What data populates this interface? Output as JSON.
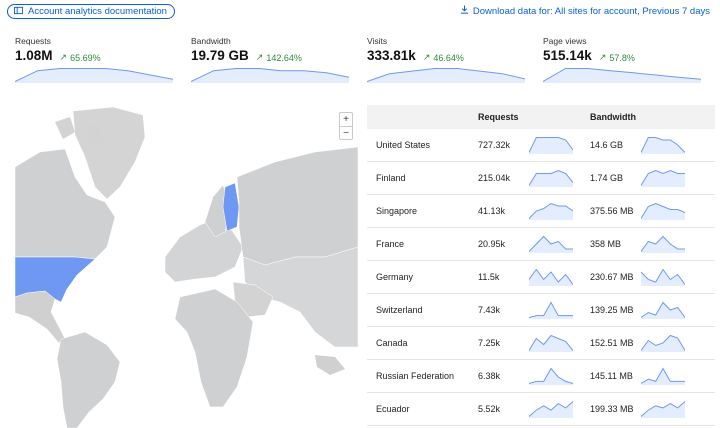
{
  "toolbar": {
    "docs_label": "Account analytics documentation",
    "download_label": "Download data for: All sites for account, Previous 7 days"
  },
  "metrics": [
    {
      "label": "Requests",
      "value": "1.08M",
      "delta": "65.69%",
      "series": [
        1,
        6,
        7,
        7,
        7,
        6,
        4,
        2
      ]
    },
    {
      "label": "Bandwidth",
      "value": "19.79 GB",
      "delta": "142.64%",
      "series": [
        1,
        6,
        7,
        7,
        6,
        6,
        5,
        3
      ]
    },
    {
      "label": "Visits",
      "value": "333.81k",
      "delta": "46.64%",
      "series": [
        1,
        4,
        5,
        6,
        6,
        5,
        4,
        2
      ]
    },
    {
      "label": "Page views",
      "value": "515.14k",
      "delta": "57.8%",
      "series": [
        1,
        7,
        7,
        6,
        5,
        4,
        3,
        2
      ]
    }
  ],
  "map": {
    "zoom_in": "+",
    "zoom_out": "−",
    "highlight_color": "#6f98f2"
  },
  "table": {
    "headers": {
      "country": "",
      "requests": "Requests",
      "bandwidth": "Bandwidth"
    },
    "rows": [
      {
        "country": "United States",
        "requests": "727.32k",
        "bandwidth": "14.6 GB",
        "req_series": [
          2,
          8,
          8,
          8,
          8,
          7,
          3
        ],
        "bw_series": [
          2,
          8,
          8,
          7,
          7,
          5,
          2
        ]
      },
      {
        "country": "Finland",
        "requests": "215.04k",
        "bandwidth": "1.74 GB",
        "req_series": [
          2,
          6,
          6,
          6,
          7,
          6,
          3
        ],
        "bw_series": [
          2,
          6,
          7,
          6,
          7,
          6,
          6
        ]
      },
      {
        "country": "Singapore",
        "requests": "41.13k",
        "bandwidth": "375.56 MB",
        "req_series": [
          2,
          5,
          6,
          8,
          7,
          7,
          5
        ],
        "bw_series": [
          3,
          7,
          8,
          7,
          6,
          6,
          5
        ]
      },
      {
        "country": "France",
        "requests": "20.95k",
        "bandwidth": "358 MB",
        "req_series": [
          2,
          5,
          8,
          5,
          6,
          3,
          3
        ],
        "bw_series": [
          2,
          6,
          5,
          8,
          5,
          3,
          3
        ]
      },
      {
        "country": "Germany",
        "requests": "11.5k",
        "bandwidth": "230.67 MB",
        "req_series": [
          4,
          8,
          4,
          7,
          3,
          6,
          2
        ],
        "bw_series": [
          7,
          4,
          3,
          8,
          4,
          6,
          2
        ]
      },
      {
        "country": "Switzerland",
        "requests": "7.43k",
        "bandwidth": "139.25 MB",
        "req_series": [
          1,
          2,
          2,
          9,
          2,
          2,
          2
        ],
        "bw_series": [
          2,
          4,
          3,
          8,
          5,
          6,
          2
        ]
      },
      {
        "country": "Canada",
        "requests": "7.25k",
        "bandwidth": "152.51 MB",
        "req_series": [
          3,
          7,
          5,
          8,
          7,
          6,
          3
        ],
        "bw_series": [
          2,
          6,
          4,
          5,
          8,
          7,
          2
        ]
      },
      {
        "country": "Russian Federation",
        "requests": "6.38k",
        "bandwidth": "145.11 MB",
        "req_series": [
          2,
          3,
          3,
          9,
          5,
          3,
          2
        ],
        "bw_series": [
          2,
          4,
          3,
          9,
          3,
          3,
          3
        ]
      },
      {
        "country": "Ecuador",
        "requests": "5.52k",
        "bandwidth": "199.33 MB",
        "req_series": [
          1,
          4,
          6,
          4,
          7,
          5,
          8
        ],
        "bw_series": [
          1,
          4,
          6,
          5,
          7,
          5,
          8
        ]
      }
    ]
  },
  "colors": {
    "accent": "#0a5fd6",
    "positive": "#2f8a3c",
    "spark_line": "#6f98f2",
    "spark_fill": "#e4edfd"
  }
}
